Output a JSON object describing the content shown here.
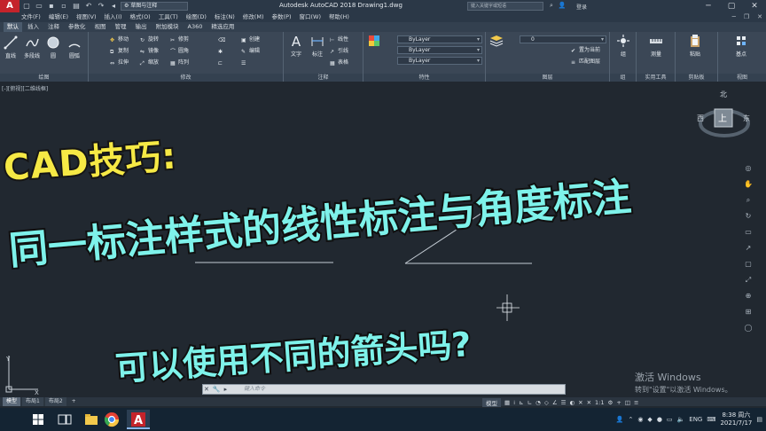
{
  "title_bar": {
    "workspace": "草图与注释",
    "window_title": "Autodesk AutoCAD 2018    Drawing1.dwg",
    "search_placeholder": "键入关键字或短语",
    "login": "登录"
  },
  "menu": [
    "文件(F)",
    "编辑(E)",
    "视图(V)",
    "插入(I)",
    "格式(O)",
    "工具(T)",
    "绘图(D)",
    "标注(N)",
    "修改(M)",
    "参数(P)",
    "窗口(W)",
    "帮助(H)"
  ],
  "ribbon_tabs": [
    {
      "label": "默认",
      "active": true
    },
    {
      "label": "插入"
    },
    {
      "label": "注释"
    },
    {
      "label": "参数化"
    },
    {
      "label": "视图"
    },
    {
      "label": "管理"
    },
    {
      "label": "输出"
    },
    {
      "label": "附加模块"
    },
    {
      "label": "A360"
    },
    {
      "label": "精选应用"
    }
  ],
  "ribbon": {
    "draw": {
      "label": "绘图",
      "line": "直线",
      "polyline": "多段线",
      "circle": "圆",
      "arc": "圆弧"
    },
    "modify": {
      "label": "修改",
      "move": "移动",
      "rotate": "旋转",
      "trim": "修剪",
      "copy": "复制",
      "mirror": "镜像",
      "fillet": "圆角",
      "stretch": "拉伸",
      "scale": "缩放",
      "array": "阵列"
    },
    "annotation": {
      "label": "注释",
      "text": "文字",
      "dimension": "标注",
      "linear": "线性",
      "leader": "引线",
      "table": "表格"
    },
    "layers": {
      "label": "图层",
      "layer_props": "图层\n特性",
      "current_layer": "0",
      "set_current": "置为当前",
      "match_layer": "匹配图层"
    },
    "block": {
      "label": "块",
      "insert": "插入",
      "create": "创建",
      "edit": "编辑"
    },
    "properties": {
      "label": "特性",
      "match": "特性\n匹配",
      "bylayer_1": "ByLayer",
      "bylayer_2": "ByLayer",
      "bylayer_3": "ByLayer"
    },
    "groups": {
      "label": "组",
      "group": "组"
    },
    "utilities": {
      "label": "实用工具",
      "measure": "测量"
    },
    "clipboard": {
      "label": "剪贴板",
      "paste": "粘贴"
    },
    "view": {
      "label": "视图",
      "base": "基点"
    }
  },
  "viewport_label": "[-][俯视][二维线框]",
  "overlay": {
    "banner": "CAD技巧:",
    "headline": "同一标注样式的线性标注与角度标注",
    "subline": "可以使用不同的箭头吗?"
  },
  "viewcube": {
    "north": "北",
    "west": "西",
    "east": "东",
    "face": "上"
  },
  "watermark": {
    "line1": "激活 Windows",
    "line2": "转到\"设置\"以激活 Windows。"
  },
  "command_line": {
    "placeholder": "键入命令"
  },
  "layout_tabs": [
    {
      "label": "模型",
      "active": true
    },
    {
      "label": "布局1"
    },
    {
      "label": "布局2"
    },
    {
      "label": "+"
    }
  ],
  "status": {
    "model": "模型",
    "scale": "1:1"
  },
  "taskbar": {
    "lang": "ENG",
    "time": "8:38 周六",
    "date": "2021/7/17"
  }
}
